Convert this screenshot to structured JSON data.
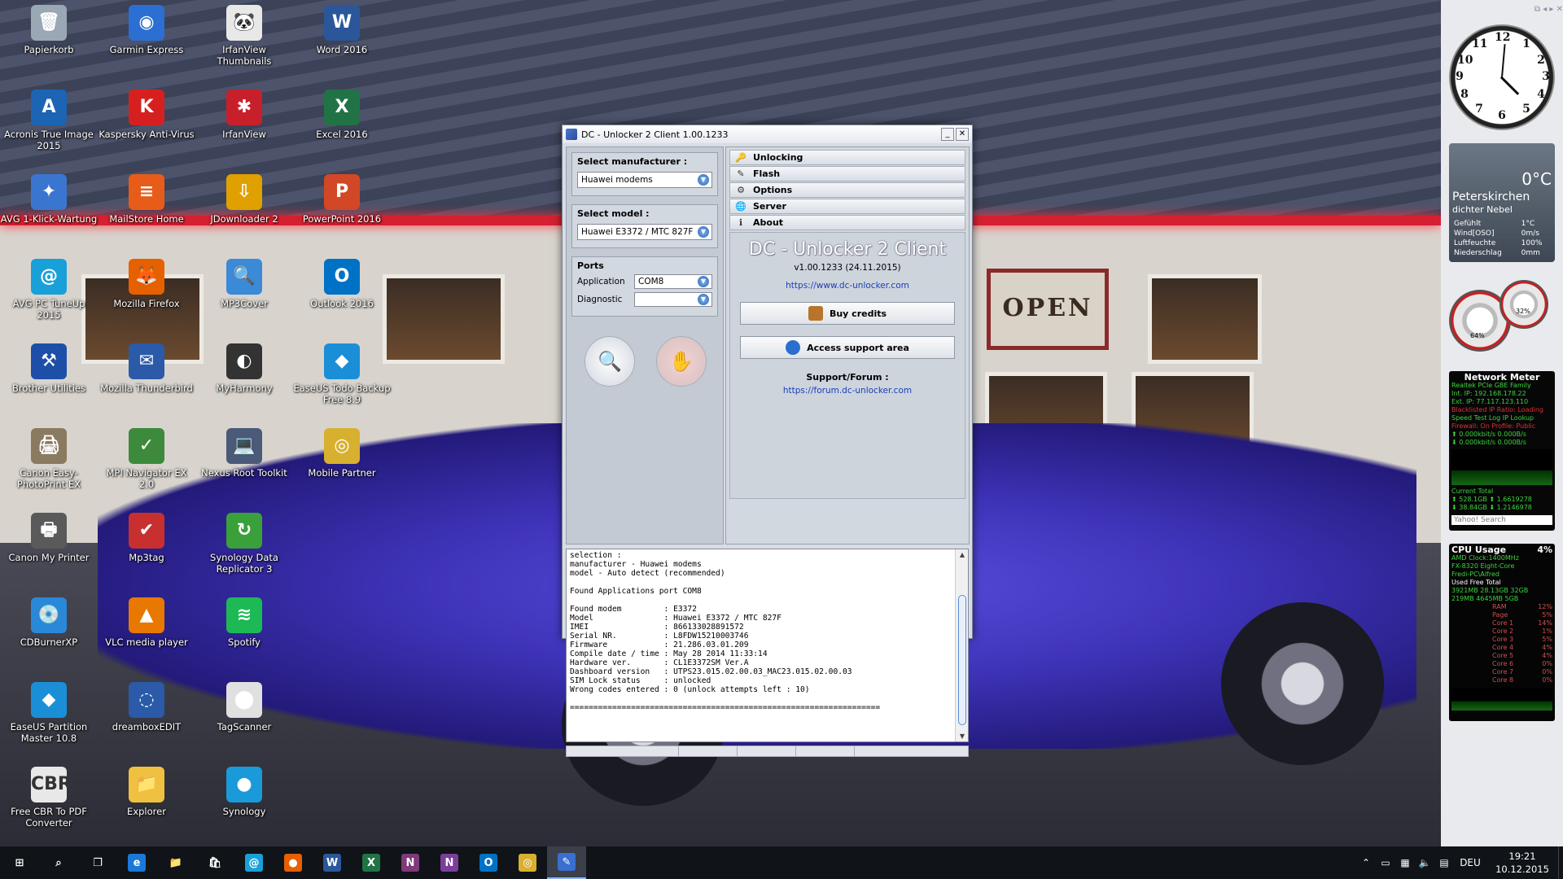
{
  "desktop": {
    "icons": [
      {
        "label": "Papierkorb",
        "icon": "recycle-bin-icon",
        "color": "#9aa7b5",
        "glyph": "🗑"
      },
      {
        "label": "Garmin Express",
        "icon": "garmin-icon",
        "color": "#2a6fd1",
        "glyph": "◉"
      },
      {
        "label": "IrfanView Thumbnails",
        "icon": "panda-icon",
        "color": "#e8e8e8",
        "glyph": "🐼"
      },
      {
        "label": "Word 2016",
        "icon": "word-icon",
        "color": "#2b579a",
        "glyph": "W"
      },
      {
        "label": "Acronis True Image 2015",
        "icon": "acronis-icon",
        "color": "#1c64b4",
        "glyph": "A"
      },
      {
        "label": "Kaspersky Anti-Virus",
        "icon": "kaspersky-icon",
        "color": "#d62020",
        "glyph": "K"
      },
      {
        "label": "IrfanView",
        "icon": "irfanview-icon",
        "color": "#c8202a",
        "glyph": "✱"
      },
      {
        "label": "Excel 2016",
        "icon": "excel-icon",
        "color": "#217346",
        "glyph": "X"
      },
      {
        "label": "AVG 1-Klick-Wartung",
        "icon": "avg-icon",
        "color": "#3a76d0",
        "glyph": "✦"
      },
      {
        "label": "MailStore Home",
        "icon": "mailstore-icon",
        "color": "#e85c1a",
        "glyph": "≡"
      },
      {
        "label": "JDownloader 2",
        "icon": "jdownloader-icon",
        "color": "#e0a000",
        "glyph": "⇩"
      },
      {
        "label": "PowerPoint 2016",
        "icon": "powerpoint-icon",
        "color": "#d24726",
        "glyph": "P"
      },
      {
        "label": "AVG PC TuneUp 2015",
        "icon": "tuneup-icon",
        "color": "#1aa0d8",
        "glyph": "@"
      },
      {
        "label": "Mozilla Firefox",
        "icon": "firefox-icon",
        "color": "#e66000",
        "glyph": "🦊"
      },
      {
        "label": "MP3Cover",
        "icon": "mp3cover-icon",
        "color": "#3a8ad8",
        "glyph": "🔍"
      },
      {
        "label": "Outlook 2016",
        "icon": "outlook-icon",
        "color": "#0072c6",
        "glyph": "O"
      },
      {
        "label": "Brother Utilities",
        "icon": "brother-icon",
        "color": "#1d4fa8",
        "glyph": "⚒"
      },
      {
        "label": "Mozilla Thunderbird",
        "icon": "thunderbird-icon",
        "color": "#2a5aa8",
        "glyph": "✉"
      },
      {
        "label": "MyHarmony",
        "icon": "harmony-icon",
        "color": "#333333",
        "glyph": "◐"
      },
      {
        "label": "EaseUS Todo Backup Free 8.9",
        "icon": "easeus-backup-icon",
        "color": "#1a8fd8",
        "glyph": "◆"
      },
      {
        "label": "Canon Easy-PhotoPrint EX",
        "icon": "canon-photoprint-icon",
        "color": "#8a7a60",
        "glyph": "🖨"
      },
      {
        "label": "MPI Navigator EX 2.0",
        "icon": "mpi-navigator-icon",
        "color": "#3d8a3d",
        "glyph": "✓"
      },
      {
        "label": "Nexus Root Toolkit",
        "icon": "nexus-icon",
        "color": "#4a5a78",
        "glyph": "💻"
      },
      {
        "label": "Mobile Partner",
        "icon": "mobile-partner-icon",
        "color": "#d8b030",
        "glyph": "◎"
      },
      {
        "label": "Canon My Printer",
        "icon": "canon-printer-icon",
        "color": "#5a5a5a",
        "glyph": "🖶"
      },
      {
        "label": "Mp3tag",
        "icon": "mp3tag-icon",
        "color": "#c83030",
        "glyph": "✔"
      },
      {
        "label": "Synology Data Replicator 3",
        "icon": "synology-replicator-icon",
        "color": "#3aa03a",
        "glyph": "↻"
      },
      {
        "label": "",
        "icon": "blank-icon",
        "color": "transparent",
        "glyph": ""
      },
      {
        "label": "CDBurnerXP",
        "icon": "cdburner-icon",
        "color": "#2a88d8",
        "glyph": "💿"
      },
      {
        "label": "VLC media player",
        "icon": "vlc-icon",
        "color": "#e87800",
        "glyph": "▲"
      },
      {
        "label": "Spotify",
        "icon": "spotify-icon",
        "color": "#1db954",
        "glyph": "≋"
      },
      {
        "label": "",
        "icon": "blank-icon",
        "color": "transparent",
        "glyph": ""
      },
      {
        "label": "EaseUS Partition Master 10.8",
        "icon": "easeus-partition-icon",
        "color": "#1a8fd8",
        "glyph": "◆"
      },
      {
        "label": "dreamboxEDIT",
        "icon": "dreambox-icon",
        "color": "#2a5aa8",
        "glyph": "◌"
      },
      {
        "label": "TagScanner",
        "icon": "tagscanner-icon",
        "color": "#e0e0e0",
        "glyph": "⬤"
      },
      {
        "label": "",
        "icon": "blank-icon",
        "color": "transparent",
        "glyph": ""
      },
      {
        "label": "Free CBR To PDF Converter",
        "icon": "cbr-icon",
        "color": "#e8e8e8",
        "glyph": "CBR"
      },
      {
        "label": "Explorer",
        "icon": "explorer-folder-icon",
        "color": "#f0c040",
        "glyph": "📁"
      },
      {
        "label": "Synology",
        "icon": "synology-icon",
        "color": "#1a9ad8",
        "glyph": "●"
      }
    ]
  },
  "app": {
    "title": "DC - Unlocker 2 Client 1.00.1233",
    "manufacturer_label": "Select manufacturer :",
    "manufacturer_value": "Huawei modems",
    "model_label": "Select model :",
    "model_value": "Huawei E3372 / MTC 827F",
    "ports_label": "Ports",
    "application_label": "Application",
    "application_value": "COM8",
    "diagnostic_label": "Diagnostic",
    "diagnostic_value": "",
    "menu": [
      {
        "label": "Unlocking",
        "icon": "key-icon",
        "glyph": "🔑"
      },
      {
        "label": "Flash",
        "icon": "flash-icon",
        "glyph": "✎"
      },
      {
        "label": "Options",
        "icon": "options-icon",
        "glyph": "⚙"
      },
      {
        "label": "Server",
        "icon": "server-icon",
        "glyph": "🌐"
      },
      {
        "label": "About",
        "icon": "info-icon",
        "glyph": "ℹ"
      }
    ],
    "about_title": "DC - Unlocker 2 Client",
    "about_version": "v1.00.1233 (24.11.2015)",
    "about_link": "https://www.dc-unlocker.com",
    "buy_credits": "Buy credits",
    "access_support": "Access support area",
    "support_label": "Support/Forum :",
    "forum_link": "https://forum.dc-unlocker.com",
    "log": "selection :\nmanufacturer - Huawei modems\nmodel - Auto detect (recommended)\n\nFound Applications port COM8\n\nFound modem         : E3372\nModel               : Huawei E3372 / MTC 827F\nIMEI                : 866133028891572\nSerial NR.          : L8FDW15210003746\nFirmware            : 21.286.03.01.209\nCompile date / time : May 28 2014 11:33:14\nHardware ver.       : CL1E3372SM Ver.A\nDashboard version   : UTPS23.015.02.00.03_MAC23.015.02.00.03\nSIM Lock status     : unlocked\nWrong codes entered : 0 (unlock attempts left : 10)\n\n=================================================================="
  },
  "sidebar": {
    "weather": {
      "temp": "0°C",
      "city": "Peterskirchen",
      "condition": "dichter Nebel",
      "rows": [
        {
          "k": "Gefühlt",
          "v": "1°C"
        },
        {
          "k": "Wind[OSO]",
          "v": "0m/s"
        },
        {
          "k": "Luftfeuchte",
          "v": "100%"
        },
        {
          "k": "Niederschlag",
          "v": "0mm"
        }
      ]
    },
    "gauges": {
      "left": "64%",
      "right": "32%"
    },
    "network": {
      "title": "Network Meter",
      "lines": [
        "Realtek PCIe GBE Family",
        "Int. IP: 192.168.178.22",
        "Ext. IP: 77.117.123.110",
        "Blacklisted IP Ratio: Loading",
        "Speed Test    Log    IP Lookup",
        "Firewall: On    Profile: Public",
        "⬆ 0.000kbit/s      0.000B/s",
        "⬇ 0.000kbit/s      0.000B/s"
      ],
      "footer": [
        "Current          Total",
        "⬆ 528.1GB    ⬆ 1.6619278",
        "⬇ 38.84GB    ⬇ 1.2146978"
      ],
      "search": "Yahoo! Search"
    },
    "cpu": {
      "title": "CPU Usage",
      "value": "4%",
      "lines": [
        "AMD  Clock:1400MHz",
        "FX-8320 Eight-Core",
        "Fredi-PC\\Alfred"
      ],
      "mem_head": "Used     Free     Total",
      "mem_rows": [
        "3921MB  28.13GB  32GB",
        "219MB   4645MB   5GB"
      ],
      "cores": [
        {
          "k": "RAM",
          "v": "12%"
        },
        {
          "k": "Page",
          "v": "5%"
        },
        {
          "k": "Core 1",
          "v": "14%"
        },
        {
          "k": "Core 2",
          "v": "1%"
        },
        {
          "k": "Core 3",
          "v": "5%"
        },
        {
          "k": "Core 4",
          "v": "4%"
        },
        {
          "k": "Core 5",
          "v": "4%"
        },
        {
          "k": "Core 6",
          "v": "0%"
        },
        {
          "k": "Core 7",
          "v": "0%"
        },
        {
          "k": "Core 8",
          "v": "0%"
        }
      ]
    }
  },
  "taskbar": {
    "apps": [
      {
        "name": "start-button",
        "glyph": "⊞",
        "color": "transparent"
      },
      {
        "name": "search-icon",
        "glyph": "⌕",
        "color": "transparent"
      },
      {
        "name": "task-view-icon",
        "glyph": "❐",
        "color": "transparent"
      },
      {
        "name": "edge-icon",
        "glyph": "e",
        "color": "#1a78d8"
      },
      {
        "name": "explorer-icon",
        "glyph": "📁",
        "color": "transparent"
      },
      {
        "name": "store-icon",
        "glyph": "🛍",
        "color": "transparent"
      },
      {
        "name": "tuneup-taskbar-icon",
        "glyph": "@",
        "color": "#1aa0d8"
      },
      {
        "name": "firefox-taskbar-icon",
        "glyph": "●",
        "color": "#e66000"
      },
      {
        "name": "word-taskbar-icon",
        "glyph": "W",
        "color": "#2b579a"
      },
      {
        "name": "excel-taskbar-icon",
        "glyph": "X",
        "color": "#217346"
      },
      {
        "name": "onenote-taskbar-icon",
        "glyph": "N",
        "color": "#80397b"
      },
      {
        "name": "onenote2-taskbar-icon",
        "glyph": "N",
        "color": "#7b3f9a"
      },
      {
        "name": "outlook-taskbar-icon",
        "glyph": "O",
        "color": "#0072c6"
      },
      {
        "name": "mobile-partner-taskbar-icon",
        "glyph": "◎",
        "color": "#d8b030"
      },
      {
        "name": "dc-unlocker-taskbar-icon",
        "glyph": "✎",
        "color": "#3a6ed0"
      }
    ],
    "tray": {
      "lang": "DEU",
      "time": "19:21",
      "date": "10.12.2015"
    }
  }
}
